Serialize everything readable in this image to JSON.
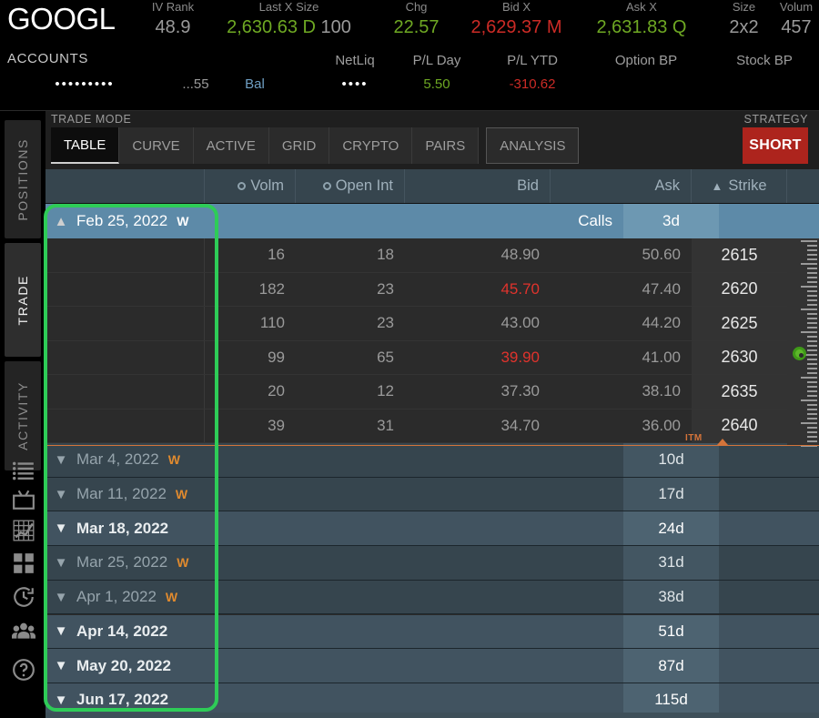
{
  "quote": {
    "symbol": "GOOGL",
    "fields": [
      {
        "label": "IV Rank",
        "value": "48.9",
        "color": "gray"
      },
      {
        "label": "Last X Size",
        "value": "2,630.63",
        "suffix": "D",
        "extra": "100",
        "color": "green"
      },
      {
        "label": "Chg",
        "value": "22.57",
        "color": "green"
      },
      {
        "label": "Bid X",
        "value": "2,629.37",
        "suffix": "M",
        "color": "red"
      },
      {
        "label": "Ask X",
        "value": "2,631.83",
        "suffix": "Q",
        "color": "green"
      },
      {
        "label": "Size",
        "value": "2x2",
        "color": "gray"
      },
      {
        "label": "Volum",
        "value": "457",
        "color": "gray"
      }
    ]
  },
  "accounts": {
    "label": "ACCOUNTS",
    "account_name_masked": "•••••••••",
    "account_number": "...55",
    "mode": "Bal",
    "columns": [
      {
        "header": "NetLiq",
        "value": "••••",
        "color": "white"
      },
      {
        "header": "P/L Day",
        "value": "5.50",
        "color": "green"
      },
      {
        "header": "P/L YTD",
        "value": "-310.62",
        "color": "red"
      },
      {
        "header": "Option BP",
        "value": "",
        "color": "gray"
      },
      {
        "header": "Stock BP",
        "value": "",
        "color": "gray"
      }
    ]
  },
  "rail": {
    "tabs": [
      {
        "label": "POSITIONS",
        "active": false
      },
      {
        "label": "TRADE",
        "active": true
      },
      {
        "label": "ACTIVITY",
        "active": false
      }
    ],
    "icons": [
      "list-icon",
      "monitor-icon",
      "chart-grid-icon",
      "grid-icon",
      "history-clock-icon",
      "people-icon",
      "help-icon"
    ]
  },
  "trade_mode": {
    "label": "TRADE MODE",
    "strategy_label": "STRATEGY",
    "strategy_value": "SHORT",
    "strategy_color": "#ad241d",
    "tabs": [
      {
        "label": "TABLE",
        "selected": true
      },
      {
        "label": "CURVE",
        "selected": false
      },
      {
        "label": "ACTIVE",
        "selected": false
      },
      {
        "label": "GRID",
        "selected": false
      },
      {
        "label": "CRYPTO",
        "selected": false
      },
      {
        "label": "PAIRS",
        "selected": false
      },
      {
        "label": "ANALYSIS",
        "selected": false,
        "outline": true
      }
    ]
  },
  "table": {
    "headers": {
      "spacer": "",
      "volm": "Volm",
      "open_int": "Open Int",
      "bid": "Bid",
      "ask": "Ask",
      "strike": "Strike"
    },
    "expanded_expiration": {
      "date": "Feb 25, 2022",
      "badge": "W",
      "side_label": "Calls",
      "days": "3d"
    },
    "option_rows": [
      {
        "volm": "16",
        "open_int": "18",
        "bid": "48.90",
        "bid_red": false,
        "ask": "50.60",
        "strike": "2615"
      },
      {
        "volm": "182",
        "open_int": "23",
        "bid": "45.70",
        "bid_red": true,
        "ask": "47.40",
        "strike": "2620"
      },
      {
        "volm": "110",
        "open_int": "23",
        "bid": "43.00",
        "bid_red": false,
        "ask": "44.20",
        "strike": "2625"
      },
      {
        "volm": "99",
        "open_int": "65",
        "bid": "39.90",
        "bid_red": true,
        "ask": "41.00",
        "strike": "2630"
      },
      {
        "volm": "20",
        "open_int": "12",
        "bid": "37.30",
        "bid_red": false,
        "ask": "38.10",
        "strike": "2635"
      },
      {
        "volm": "39",
        "open_int": "31",
        "bid": "34.70",
        "bid_red": false,
        "ask": "36.00",
        "strike": "2640"
      }
    ],
    "itm_marker": "ITM",
    "expirations": [
      {
        "date": "Mar 4, 2022",
        "badge": "W",
        "days": "10d",
        "monthly": false
      },
      {
        "date": "Mar 11, 2022",
        "badge": "W",
        "days": "17d",
        "monthly": false
      },
      {
        "date": "Mar 18, 2022",
        "badge": "",
        "days": "24d",
        "monthly": true
      },
      {
        "date": "Mar 25, 2022",
        "badge": "W",
        "days": "31d",
        "monthly": false
      },
      {
        "date": "Apr 1, 2022",
        "badge": "W",
        "days": "38d",
        "monthly": false
      },
      {
        "date": "Apr 14, 2022",
        "badge": "",
        "days": "51d",
        "monthly": true
      },
      {
        "date": "May 20, 2022",
        "badge": "",
        "days": "87d",
        "monthly": true
      },
      {
        "date": "Jun 17, 2022",
        "badge": "",
        "days": "115d",
        "monthly": true
      }
    ]
  },
  "annotation": {
    "highlight_color": "#2ecc57"
  }
}
